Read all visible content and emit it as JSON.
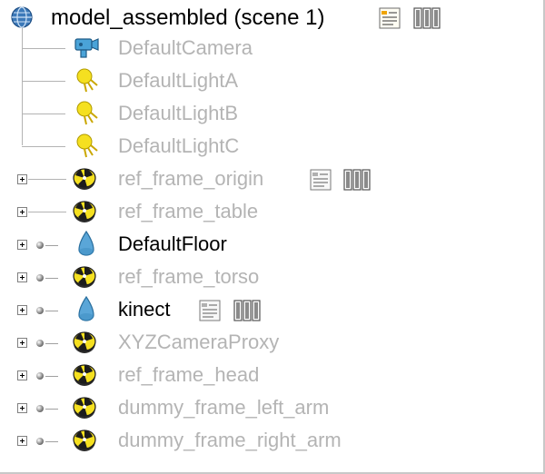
{
  "tree": {
    "root": {
      "label": "model_assembled (scene 1)"
    },
    "items": [
      {
        "label": "DefaultCamera",
        "muted": true
      },
      {
        "label": "DefaultLightA",
        "muted": true
      },
      {
        "label": "DefaultLightB",
        "muted": true
      },
      {
        "label": "DefaultLightC",
        "muted": true
      },
      {
        "label": "ref_frame_origin",
        "muted": true
      },
      {
        "label": "ref_frame_table",
        "muted": true
      },
      {
        "label": "DefaultFloor",
        "muted": false
      },
      {
        "label": "ref_frame_torso",
        "muted": true
      },
      {
        "label": "kinect",
        "muted": false
      },
      {
        "label": "XYZCameraProxy",
        "muted": true
      },
      {
        "label": "ref_frame_head",
        "muted": true
      },
      {
        "label": "dummy_frame_left_arm",
        "muted": true
      },
      {
        "label": "dummy_frame_right_arm",
        "muted": true
      }
    ]
  },
  "icons": {
    "root": "globe-icon",
    "camera": "camera-icon",
    "light": "light-icon",
    "dummy": "dummy-frame-icon",
    "shape": "shape-icon",
    "script": "script-icon",
    "film": "film-icon"
  },
  "colors": {
    "muted_text": "#b4b4b4",
    "tree_line": "#b3b3b3",
    "light_yellow": "#f5e020",
    "shape_blue": "#5aa6d8",
    "globe_blue": "#3c79b9"
  }
}
